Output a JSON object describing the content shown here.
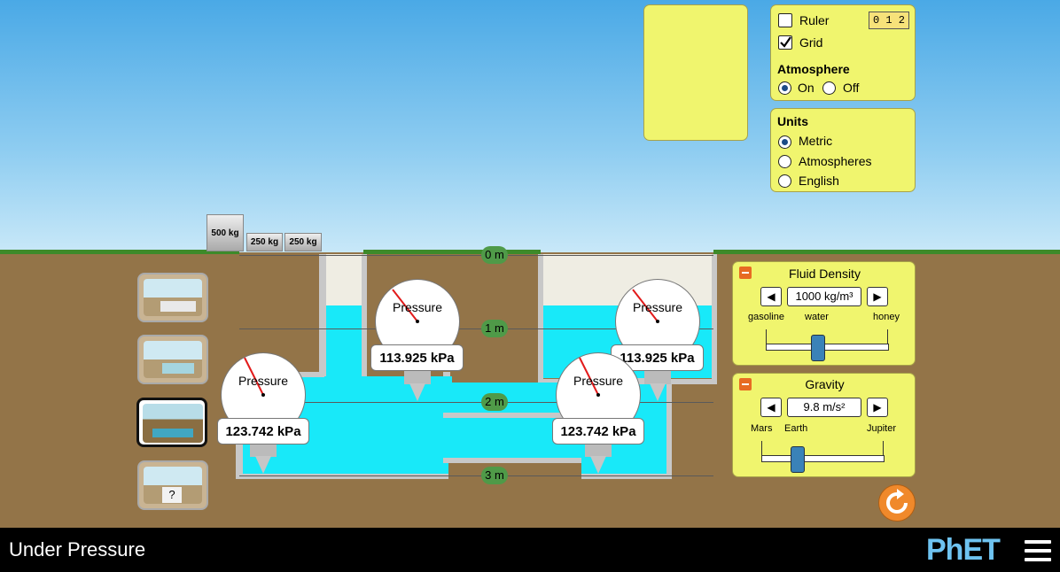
{
  "sim": {
    "title": "Under Pressure",
    "brand": "PhET"
  },
  "controls": {
    "ruler_label": "Ruler",
    "ruler_checked": false,
    "ruler_icon_text": "0  1  2",
    "grid_label": "Grid",
    "grid_checked": true,
    "atmosphere_title": "Atmosphere",
    "atmosphere_on": "On",
    "atmosphere_off": "Off",
    "atmosphere_selected": "On"
  },
  "units": {
    "title": "Units",
    "options": [
      "Metric",
      "Atmospheres",
      "English"
    ],
    "selected": "Metric"
  },
  "fluid_density": {
    "title": "Fluid Density",
    "value": "1000 kg/m³",
    "labels": {
      "left": "gasoline",
      "mid": "water",
      "right": "honey"
    }
  },
  "gravity": {
    "title": "Gravity",
    "value": "9.8 m/s²",
    "labels": {
      "left": "Mars",
      "mid": "Earth",
      "right": "Jupiter"
    }
  },
  "weights": [
    "500 kg",
    "250 kg",
    "250 kg"
  ],
  "depth_markers": [
    "0 m",
    "1 m",
    "2 m",
    "3 m"
  ],
  "gauges": [
    {
      "label": "Pressure",
      "reading": "113.925 kPa"
    },
    {
      "label": "Pressure",
      "reading": "113.925 kPa"
    },
    {
      "label": "Pressure",
      "reading": "123.742 kPa"
    },
    {
      "label": "Pressure",
      "reading": "123.742 kPa"
    }
  ],
  "scene_buttons": [
    {
      "name": "square-pool"
    },
    {
      "name": "trapezoid-pool"
    },
    {
      "name": "chamber-pool",
      "selected": true
    },
    {
      "name": "mystery-pool",
      "text": "?"
    }
  ],
  "colors": {
    "water": "#18e9f9",
    "panel": "#f0f56e",
    "ground": "#937448",
    "grass": "#3d8a2a",
    "reset": "#f0892b"
  }
}
